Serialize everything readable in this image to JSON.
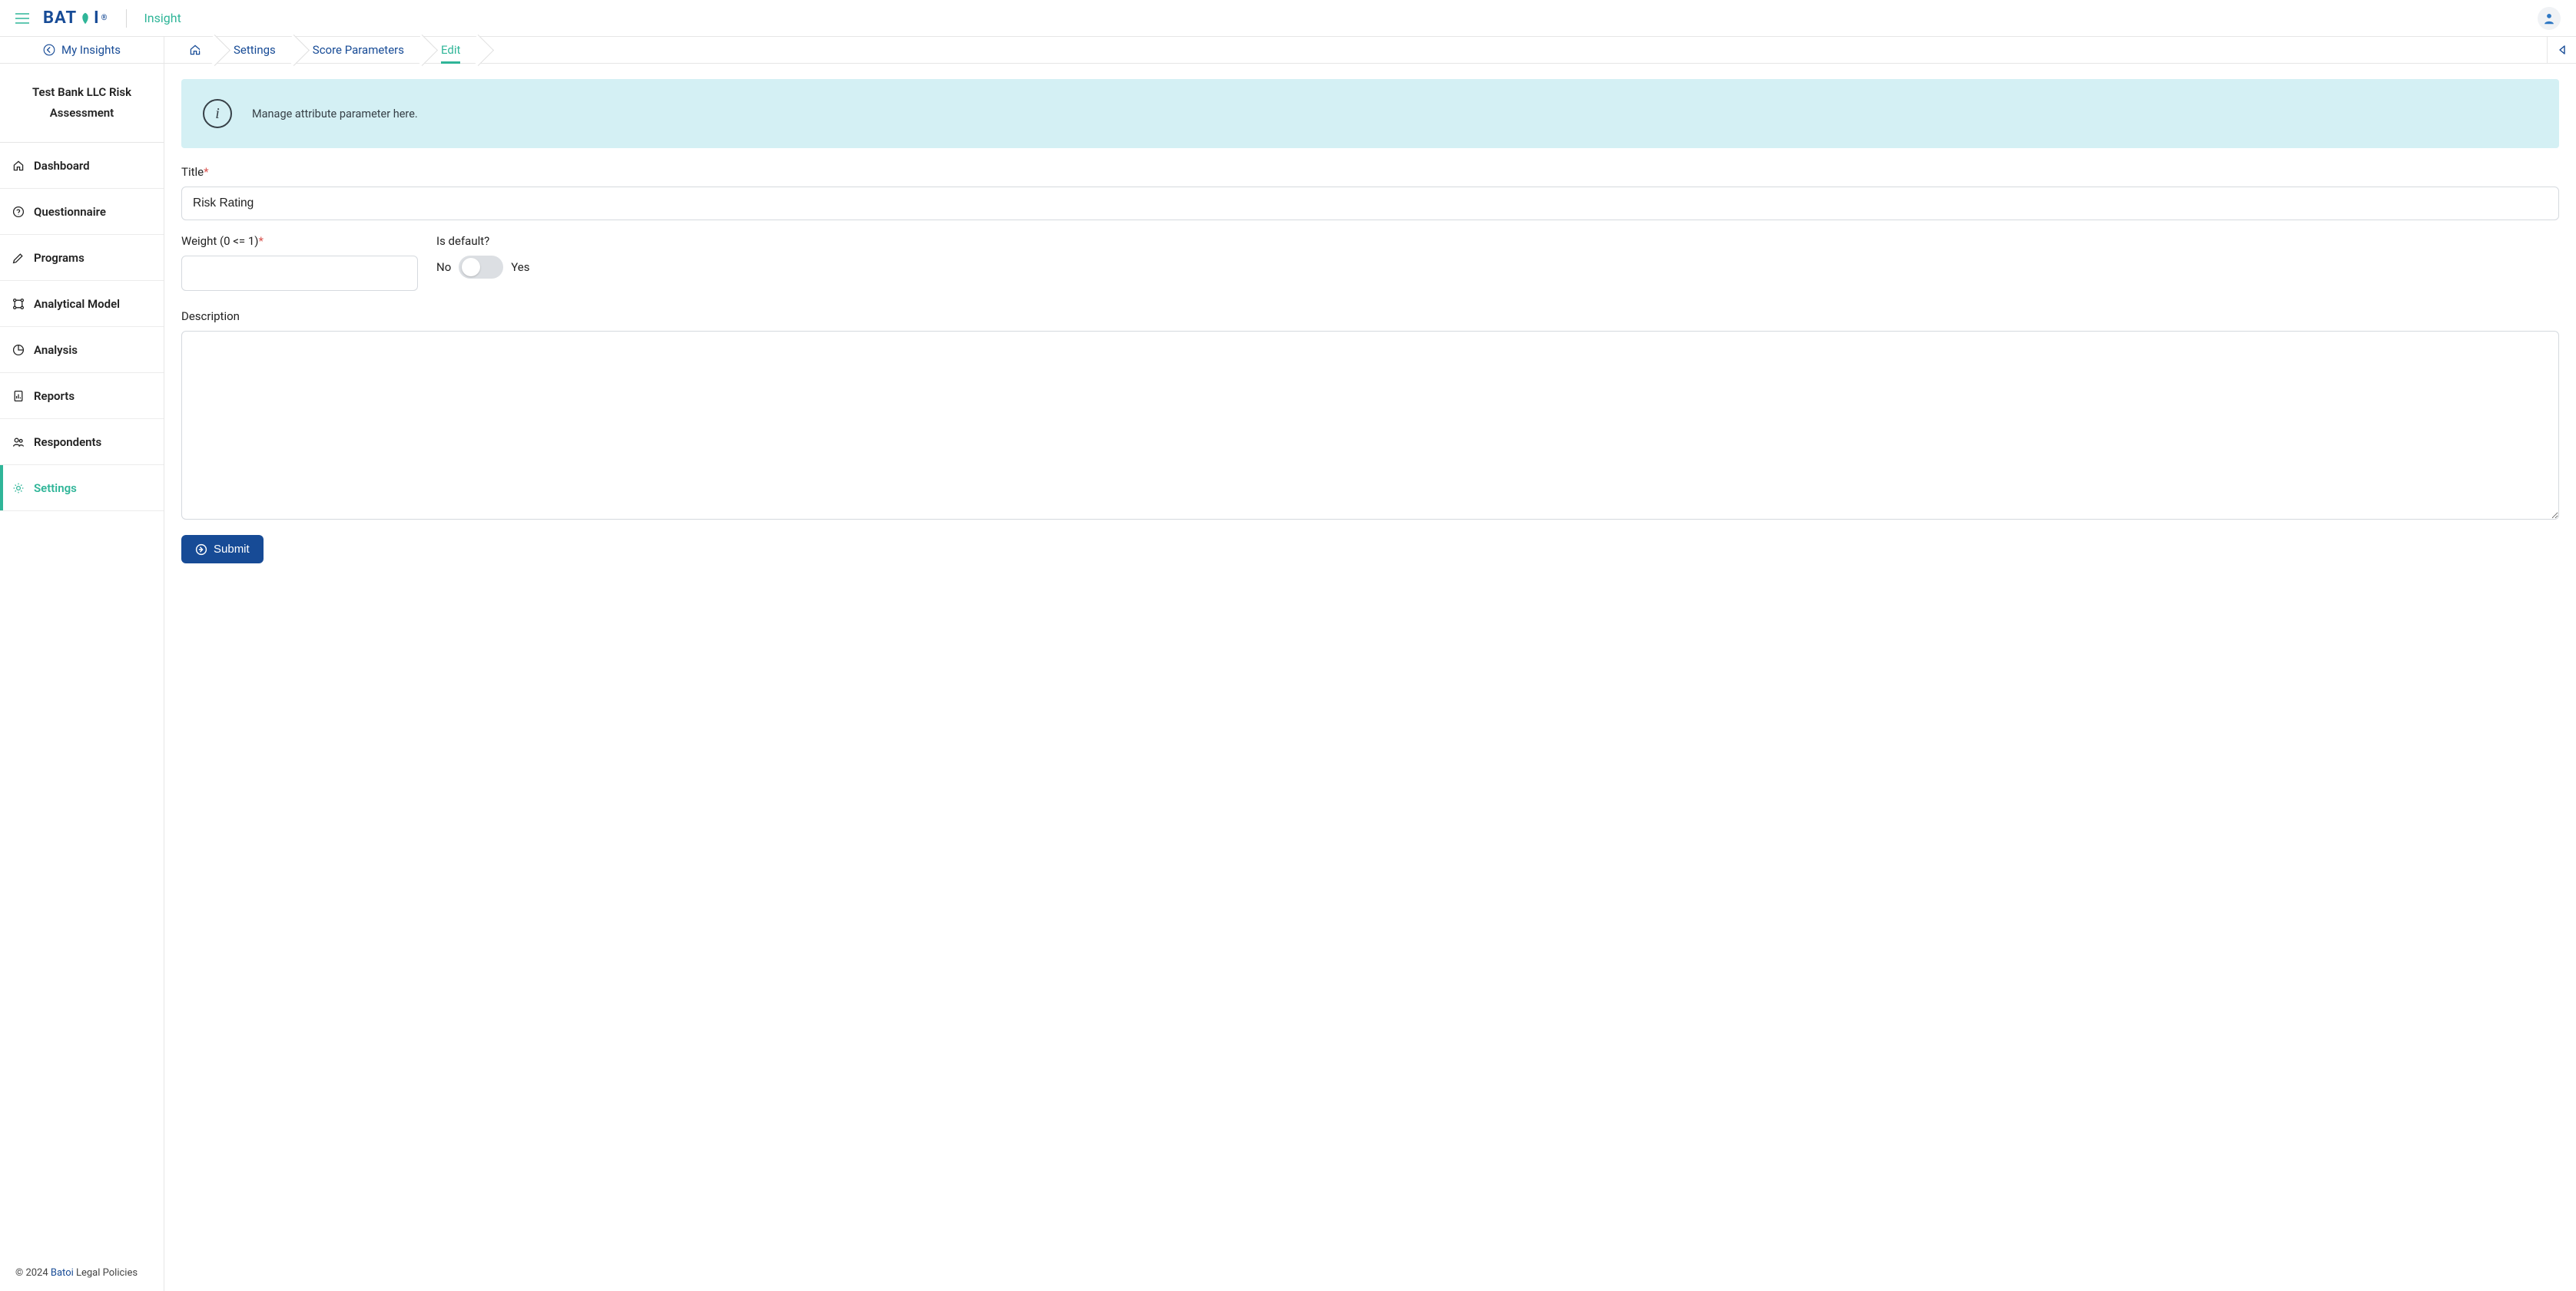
{
  "header": {
    "logo_text_1": "BAT",
    "logo_text_2": "I",
    "logo_reg": "®",
    "product": "Insight"
  },
  "sidebar": {
    "back_label": "My Insights",
    "project_title": "Test Bank LLC Risk Assessment",
    "items": [
      {
        "label": "Dashboard"
      },
      {
        "label": "Questionnaire"
      },
      {
        "label": "Programs"
      },
      {
        "label": "Analytical Model"
      },
      {
        "label": "Analysis"
      },
      {
        "label": "Reports"
      },
      {
        "label": "Respondents"
      },
      {
        "label": "Settings"
      }
    ]
  },
  "breadcrumbs": {
    "items": [
      {
        "label": "Settings"
      },
      {
        "label": "Score Parameters"
      },
      {
        "label": "Edit"
      }
    ]
  },
  "alert": {
    "text": "Manage attribute parameter here."
  },
  "form": {
    "title_label": "Title",
    "title_value": "Risk Rating",
    "weight_label": "Weight (0 <= 1)",
    "weight_value": "",
    "default_label": "Is default?",
    "no_label": "No",
    "yes_label": "Yes",
    "default_on": false,
    "description_label": "Description",
    "description_value": "",
    "submit_label": "Submit"
  },
  "footer": {
    "copyright_prefix": "© 2024 ",
    "brand": "Batoi",
    "legal": " Legal Policies"
  }
}
